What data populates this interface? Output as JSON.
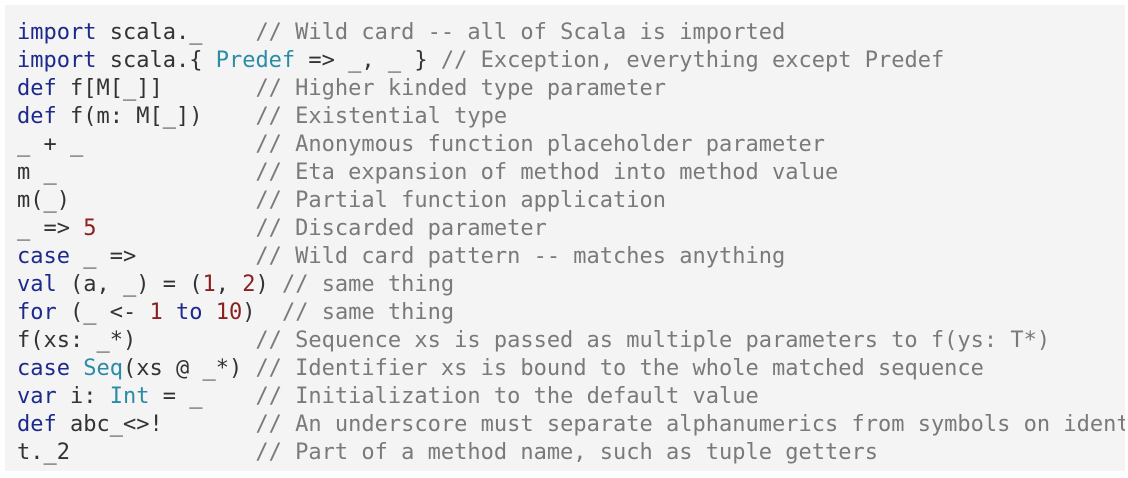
{
  "colors": {
    "background": "#f4f4f4",
    "keyword": "#1d2a8c",
    "type": "#2a8ca6",
    "number": "#8a1f1f",
    "comment": "#7a7a7a",
    "text": "#333333"
  },
  "lines": [
    [
      {
        "t": "kw",
        "v": "import"
      },
      {
        "t": "tx",
        "v": " scala._    "
      },
      {
        "t": "cm",
        "v": "// Wild card -- all of Scala is imported"
      }
    ],
    [
      {
        "t": "kw",
        "v": "import"
      },
      {
        "t": "tx",
        "v": " scala.{ "
      },
      {
        "t": "ty",
        "v": "Predef"
      },
      {
        "t": "tx",
        "v": " => _, _ } "
      },
      {
        "t": "cm",
        "v": "// Exception, everything except Predef"
      }
    ],
    [
      {
        "t": "kw",
        "v": "def"
      },
      {
        "t": "tx",
        "v": " f[M[_]]       "
      },
      {
        "t": "cm",
        "v": "// Higher kinded type parameter"
      }
    ],
    [
      {
        "t": "kw",
        "v": "def"
      },
      {
        "t": "tx",
        "v": " f(m: M[_])    "
      },
      {
        "t": "cm",
        "v": "// Existential type"
      }
    ],
    [
      {
        "t": "tx",
        "v": "_ + _             "
      },
      {
        "t": "cm",
        "v": "// Anonymous function placeholder parameter"
      }
    ],
    [
      {
        "t": "tx",
        "v": "m _               "
      },
      {
        "t": "cm",
        "v": "// Eta expansion of method into method value"
      }
    ],
    [
      {
        "t": "tx",
        "v": "m(_)              "
      },
      {
        "t": "cm",
        "v": "// Partial function application"
      }
    ],
    [
      {
        "t": "tx",
        "v": "_ => "
      },
      {
        "t": "num",
        "v": "5"
      },
      {
        "t": "tx",
        "v": "            "
      },
      {
        "t": "cm",
        "v": "// Discarded parameter"
      }
    ],
    [
      {
        "t": "kw",
        "v": "case"
      },
      {
        "t": "tx",
        "v": " _ =>         "
      },
      {
        "t": "cm",
        "v": "// Wild card pattern -- matches anything"
      }
    ],
    [
      {
        "t": "kw",
        "v": "val"
      },
      {
        "t": "tx",
        "v": " (a, _) = ("
      },
      {
        "t": "num",
        "v": "1"
      },
      {
        "t": "tx",
        "v": ", "
      },
      {
        "t": "num",
        "v": "2"
      },
      {
        "t": "tx",
        "v": ") "
      },
      {
        "t": "cm",
        "v": "// same thing"
      }
    ],
    [
      {
        "t": "kw",
        "v": "for"
      },
      {
        "t": "tx",
        "v": " (_ <- "
      },
      {
        "t": "num",
        "v": "1"
      },
      {
        "t": "tx",
        "v": " "
      },
      {
        "t": "kw",
        "v": "to"
      },
      {
        "t": "tx",
        "v": " "
      },
      {
        "t": "num",
        "v": "10"
      },
      {
        "t": "tx",
        "v": ")  "
      },
      {
        "t": "cm",
        "v": "// same thing"
      }
    ],
    [
      {
        "t": "tx",
        "v": "f(xs: _*)         "
      },
      {
        "t": "cm",
        "v": "// Sequence xs is passed as multiple parameters to f(ys: T*)"
      }
    ],
    [
      {
        "t": "kw",
        "v": "case"
      },
      {
        "t": "tx",
        "v": " "
      },
      {
        "t": "ty",
        "v": "Seq"
      },
      {
        "t": "tx",
        "v": "(xs @ _*) "
      },
      {
        "t": "cm",
        "v": "// Identifier xs is bound to the whole matched sequence"
      }
    ],
    [
      {
        "t": "kw",
        "v": "var"
      },
      {
        "t": "tx",
        "v": " i: "
      },
      {
        "t": "ty",
        "v": "Int"
      },
      {
        "t": "tx",
        "v": " = _    "
      },
      {
        "t": "cm",
        "v": "// Initialization to the default value"
      }
    ],
    [
      {
        "t": "kw",
        "v": "def"
      },
      {
        "t": "tx",
        "v": " abc_<>!       "
      },
      {
        "t": "cm",
        "v": "// An underscore must separate alphanumerics from symbols on ident"
      }
    ],
    [
      {
        "t": "tx",
        "v": "t._2              "
      },
      {
        "t": "cm",
        "v": "// Part of a method name, such as tuple getters"
      }
    ]
  ]
}
